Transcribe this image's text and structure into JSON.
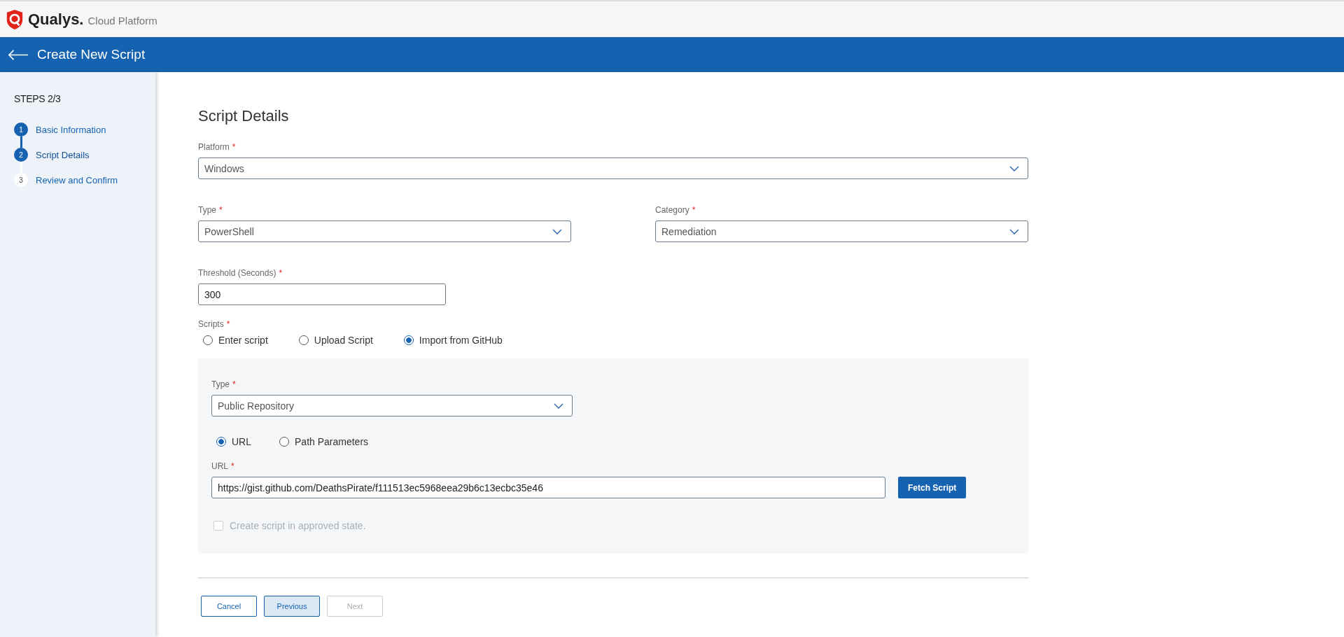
{
  "brand": {
    "name": "Qualys.",
    "product": "Cloud Platform"
  },
  "header": {
    "title": "Create New Script"
  },
  "steps": {
    "title": "STEPS 2/3",
    "items": [
      {
        "number": "1",
        "label": "Basic Information",
        "done": true,
        "selected": false
      },
      {
        "number": "2",
        "label": "Script Details",
        "done": true,
        "selected": true
      },
      {
        "number": "3",
        "label": "Review and Confirm",
        "done": false,
        "selected": false
      }
    ]
  },
  "form": {
    "title": "Script Details",
    "platform": {
      "label": "Platform",
      "required": "*",
      "value": "Windows"
    },
    "type": {
      "label": "Type",
      "required": "*",
      "value": "PowerShell"
    },
    "category": {
      "label": "Category",
      "required": "*",
      "value": "Remediation"
    },
    "threshold": {
      "label": "Threshold (Seconds)",
      "required": "*",
      "value": "300"
    },
    "scripts": {
      "label": "Scripts",
      "required": "*",
      "options": [
        {
          "label": "Enter script",
          "selected": false
        },
        {
          "label": "Upload Script",
          "selected": false
        },
        {
          "label": "Import from GitHub",
          "selected": true
        }
      ]
    },
    "github": {
      "type": {
        "label": "Type",
        "required": "*",
        "value": "Public Repository"
      },
      "source_options": [
        {
          "label": "URL",
          "selected": true
        },
        {
          "label": "Path Parameters",
          "selected": false
        }
      ],
      "url": {
        "label": "URL",
        "required": "*",
        "value": "https://gist.github.com/DeathsPirate/f111513ec5968eea29b6c13ecbc35e46"
      },
      "fetch_button": "Fetch Script",
      "approved": {
        "label": "Create script in approved state.",
        "checked": false,
        "disabled": true
      }
    }
  },
  "buttons": [
    {
      "label": "Cancel",
      "kind": "outline",
      "disabled": false
    },
    {
      "label": "Previous",
      "kind": "soft",
      "disabled": false
    },
    {
      "label": "Next",
      "kind": "outline",
      "disabled": true
    }
  ]
}
